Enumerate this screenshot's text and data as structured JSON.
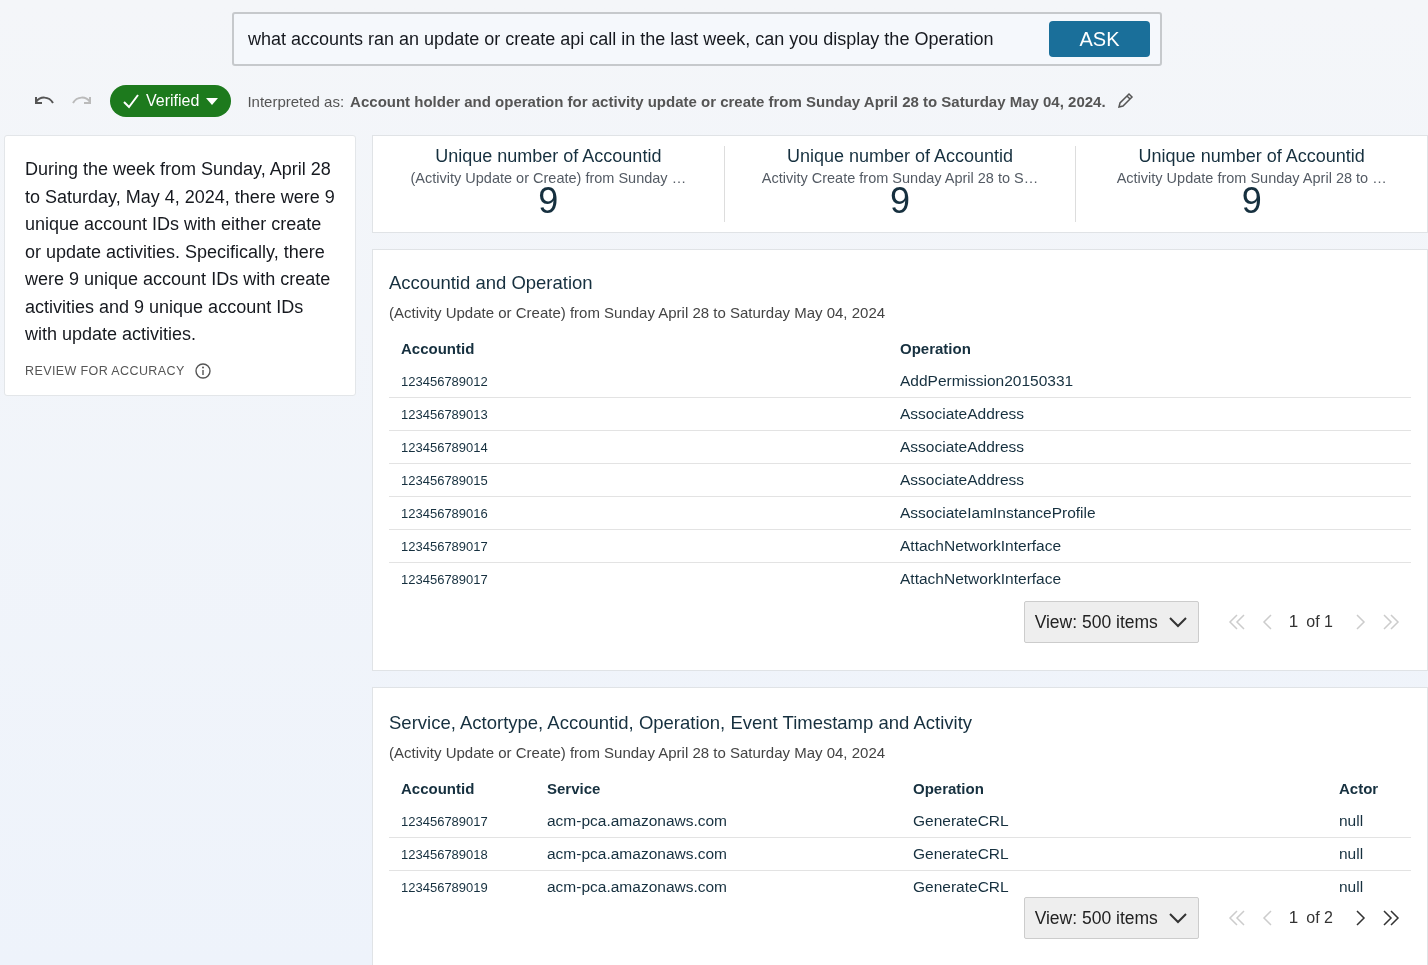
{
  "search": {
    "value": "what accounts ran an update or create api call in the last week, can you display the Operation",
    "button": "ASK"
  },
  "toolbar": {
    "undo_disabled": false,
    "redo_disabled": true,
    "verified": {
      "label": "Verified"
    },
    "interpreted_label": "Interpreted as:",
    "interpreted_text": "Account holder and operation for activity update or create from Sunday April 28 to Saturday May 04, 2024."
  },
  "summary": {
    "text": "During the week from Sunday, April 28 to Saturday, May 4, 2024, there were 9 unique account IDs with either create or update activities. Specifically, there were 9 unique account IDs with create activities and 9 unique account IDs with update activities.",
    "review": "REVIEW FOR ACCURACY"
  },
  "kpis": [
    {
      "title": "Unique number of Accountid",
      "subtitle": "(Activity Update or Create) from Sunday …",
      "value": "9"
    },
    {
      "title": "Unique number of Accountid",
      "subtitle": "Activity Create from Sunday April 28 to S…",
      "value": "9"
    },
    {
      "title": "Unique number of Accountid",
      "subtitle": "Activity Update from Sunday April 28 to …",
      "value": "9"
    }
  ],
  "tables": [
    {
      "title": "Accountid and Operation",
      "subtitle": "(Activity Update or Create) from Sunday April 28 to Saturday May 04, 2024",
      "columns": [
        "Accountid",
        "Operation"
      ],
      "rows": [
        [
          "123456789012",
          "AddPermission20150331"
        ],
        [
          "123456789013",
          "AssociateAddress"
        ],
        [
          "123456789014",
          "AssociateAddress"
        ],
        [
          "123456789015",
          "AssociateAddress"
        ],
        [
          "123456789016",
          "AssociateIamInstanceProfile"
        ],
        [
          "123456789017",
          "AttachNetworkInterface"
        ],
        [
          "123456789017",
          "AttachNetworkInterface"
        ]
      ],
      "view": "View: 500 items",
      "page": "1",
      "of": "of 1",
      "prev_disabled": true,
      "next_disabled": true
    },
    {
      "title": "Service, Actortype, Accountid, Operation, Event Timestamp and Activity",
      "subtitle": "(Activity Update or Create) from Sunday April 28 to Saturday May 04, 2024",
      "columns": [
        "Accountid",
        "Service",
        "Operation",
        "Actor"
      ],
      "rows": [
        [
          "123456789017",
          "acm-pca.amazonaws.com",
          "GenerateCRL",
          "null"
        ],
        [
          "123456789018",
          "acm-pca.amazonaws.com",
          "GenerateCRL",
          "null"
        ],
        [
          "123456789019",
          "acm-pca.amazonaws.com",
          "GenerateCRL",
          "null"
        ]
      ],
      "view": "View: 500 items",
      "page": "1",
      "of": "of 2",
      "prev_disabled": true,
      "next_disabled": false
    }
  ]
}
